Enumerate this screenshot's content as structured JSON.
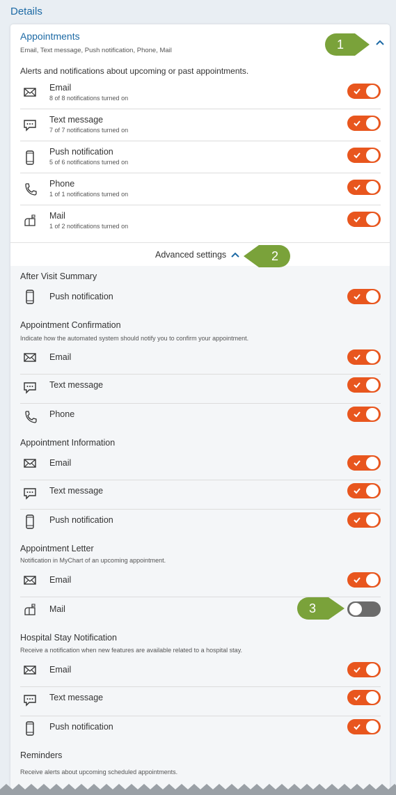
{
  "page": {
    "title": "Details"
  },
  "card": {
    "title": "Appointments",
    "summary": "Email, Text message, Push notification, Phone, Mail",
    "description": "Alerts and notifications about upcoming or past appointments.",
    "channels": [
      {
        "icon": "envelope-icon",
        "label": "Email",
        "sub": "8 of 8 notifications turned on",
        "on": true
      },
      {
        "icon": "chat-bubble-icon",
        "label": "Text message",
        "sub": "7 of 7 notifications turned on",
        "on": true
      },
      {
        "icon": "mobile-phone-icon",
        "label": "Push notification",
        "sub": "5 of 6 notifications turned on",
        "on": true
      },
      {
        "icon": "phone-handset-icon",
        "label": "Phone",
        "sub": "1 of 1 notifications turned on",
        "on": true
      },
      {
        "icon": "mailbox-icon",
        "label": "Mail",
        "sub": "1 of 2 notifications turned on",
        "on": true
      }
    ],
    "advanced_label": "Advanced settings"
  },
  "advanced": {
    "sections": [
      {
        "title": "After Visit Summary",
        "sub": "",
        "rows": [
          {
            "icon": "mobile-phone-icon",
            "label": "Push notification",
            "on": true
          }
        ]
      },
      {
        "title": "Appointment Confirmation",
        "sub": "Indicate how the automated system should notify you to confirm your appointment.",
        "rows": [
          {
            "icon": "envelope-icon",
            "label": "Email",
            "on": true
          },
          {
            "icon": "chat-bubble-icon",
            "label": "Text message",
            "on": true
          },
          {
            "icon": "phone-handset-icon",
            "label": "Phone",
            "on": true
          }
        ]
      },
      {
        "title": "Appointment Information",
        "sub": "",
        "rows": [
          {
            "icon": "envelope-icon",
            "label": "Email",
            "on": true
          },
          {
            "icon": "chat-bubble-icon",
            "label": "Text message",
            "on": true
          },
          {
            "icon": "mobile-phone-icon",
            "label": "Push notification",
            "on": true
          }
        ]
      },
      {
        "title": "Appointment Letter",
        "sub": "Notification in MyChart of an upcoming appointment.",
        "rows": [
          {
            "icon": "envelope-icon",
            "label": "Email",
            "on": true
          },
          {
            "icon": "mailbox-icon",
            "label": "Mail",
            "on": false
          }
        ]
      },
      {
        "title": "Hospital Stay Notification",
        "sub": "Receive a notification when new features are available related to a hospital stay.",
        "rows": [
          {
            "icon": "envelope-icon",
            "label": "Email",
            "on": true
          },
          {
            "icon": "chat-bubble-icon",
            "label": "Text message",
            "on": true
          },
          {
            "icon": "mobile-phone-icon",
            "label": "Push notification",
            "on": true
          }
        ]
      },
      {
        "title": "Reminders",
        "sub": "Receive alerts about upcoming scheduled appointments.",
        "rows": []
      }
    ]
  },
  "callouts": [
    "1",
    "2",
    "3"
  ],
  "colors": {
    "accent": "#1d6aa5",
    "toggle_on": "#e8561e",
    "toggle_off": "#6b6b6b",
    "callout": "#7aa23a"
  }
}
